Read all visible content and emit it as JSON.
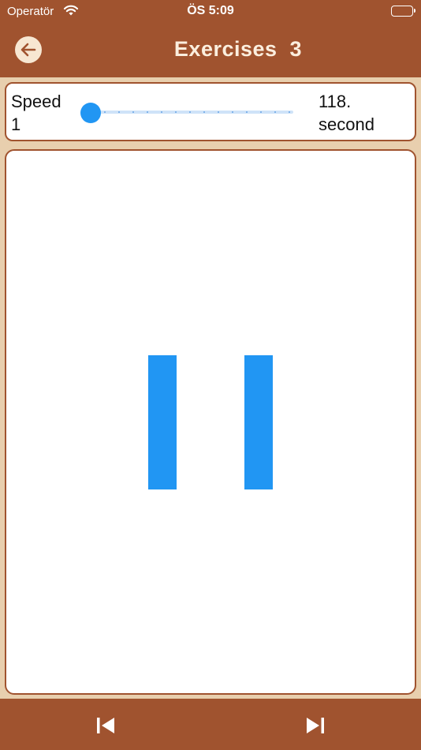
{
  "status_bar": {
    "carrier": "Operatör",
    "time": "ÖS 5:09",
    "icons": [
      "wifi-icon",
      "battery-icon"
    ]
  },
  "header": {
    "title": "Exercises  3",
    "back_icon": "arrow-left-icon"
  },
  "speed": {
    "label": "Speed 1",
    "slider_value": 0,
    "seconds_label": "118. second"
  },
  "exercise": {
    "bars": 2,
    "bar_color": "#2196f3"
  },
  "footer": {
    "prev_icon": "skip-previous-icon",
    "next_icon": "skip-next-icon"
  },
  "colors": {
    "brand": "#a0532f",
    "background": "#e8cfae",
    "accent": "#2196f3"
  }
}
